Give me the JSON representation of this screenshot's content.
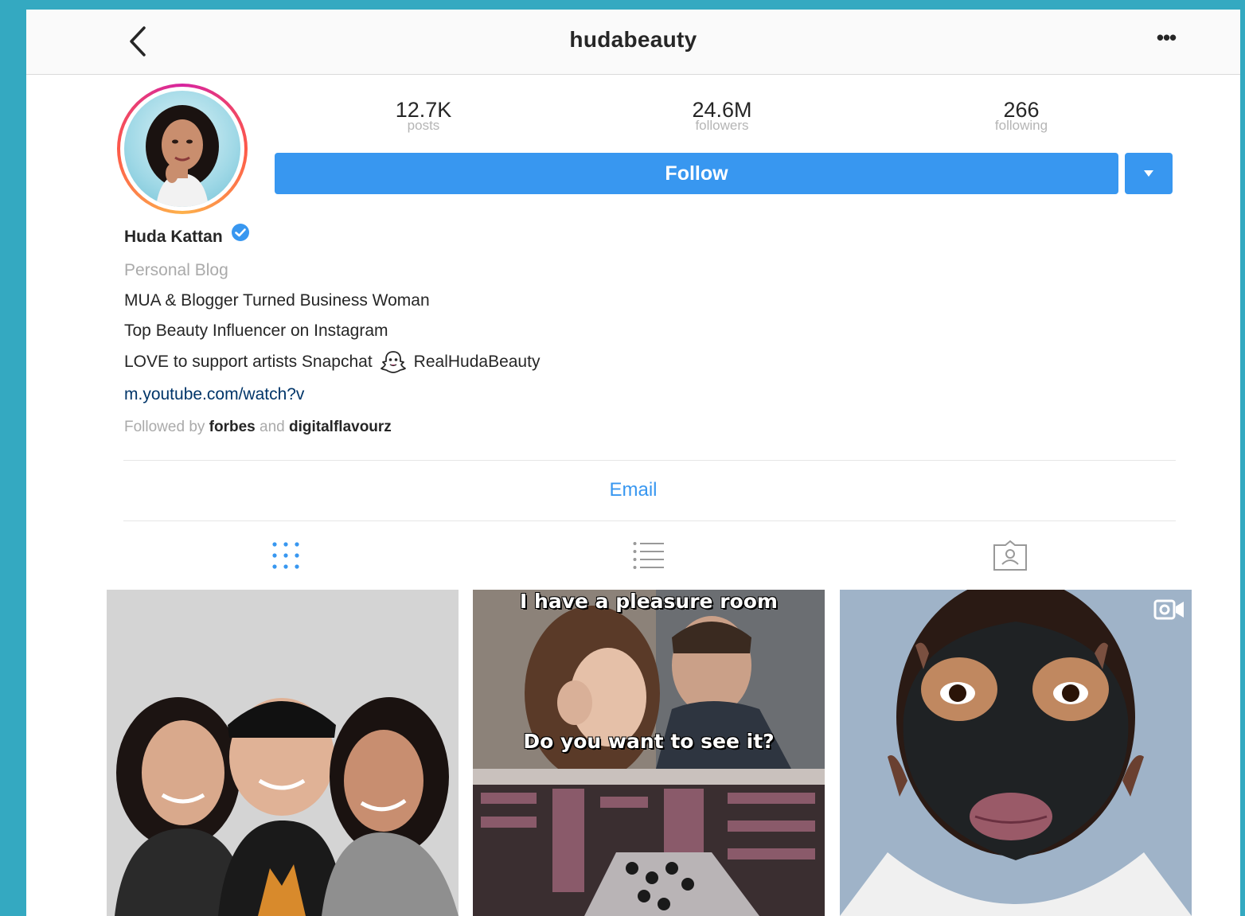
{
  "header": {
    "username": "hudabeauty",
    "back_icon": "chevron-left-icon",
    "more_label": "•••"
  },
  "profile": {
    "stats": [
      {
        "value": "12.7K",
        "label": "posts"
      },
      {
        "value": "24.6M",
        "label": "followers"
      },
      {
        "value": "266",
        "label": "following"
      }
    ],
    "follow_label": "Follow",
    "name": "Huda Kattan",
    "verified": true,
    "category": "Personal Blog",
    "bio": {
      "line1": "MUA & Blogger Turned Business Woman",
      "line2": "Top Beauty Influencer on Instagram",
      "line3_a": "LOVE to support artists Snapchat",
      "line3_b": "RealHudaBeauty"
    },
    "website": "m.youtube.com/watch?v",
    "followed_by": {
      "prefix": "Followed by",
      "user1": "forbes",
      "conj": "and",
      "user2": "digitalflavourz"
    },
    "email_label": "Email"
  },
  "tabs": [
    {
      "name": "grid",
      "icon": "grid-icon",
      "active": true
    },
    {
      "name": "list",
      "icon": "list-icon",
      "active": false
    },
    {
      "name": "tagged",
      "icon": "tagged-icon",
      "active": false
    }
  ],
  "posts": [
    {
      "caption_top": "",
      "caption_mid": ""
    },
    {
      "caption_top": "I have a pleasure room",
      "caption_mid": "Do you want to see it?"
    },
    {
      "caption_top": "",
      "caption_mid": ""
    }
  ],
  "colors": {
    "accent": "#3897f0",
    "background": "#34a9c1",
    "verified": "#3897f0"
  }
}
